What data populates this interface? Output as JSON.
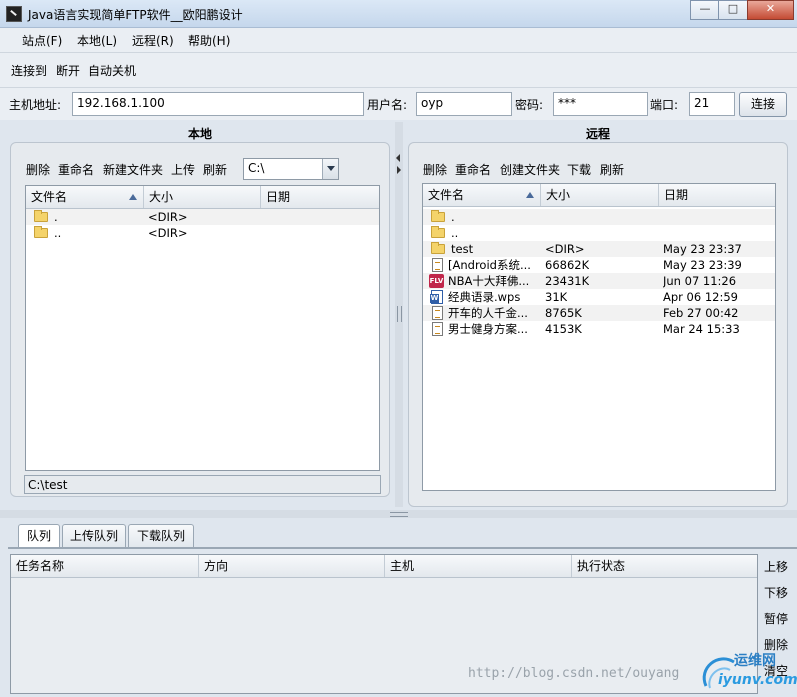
{
  "window": {
    "title": "Java语言实现简单FTP软件__欧阳鹏设计",
    "minimize_label": "—",
    "maximize_label": "□",
    "close_label": "✕"
  },
  "menu": {
    "items": [
      {
        "label": "站点(F)"
      },
      {
        "label": "本地(L)"
      },
      {
        "label": "远程(R)"
      },
      {
        "label": "帮助(H)"
      }
    ]
  },
  "toolbar": {
    "connect_to": "连接到",
    "disconnect": "断开",
    "auto_shutdown": "自动关机"
  },
  "connection": {
    "host_label": "主机地址:",
    "host_value": "192.168.1.100",
    "user_label": "用户名:",
    "user_value": "oyp",
    "password_label": "密码:",
    "password_value": "***",
    "port_label": "端口:",
    "port_value": "21",
    "connect_button": "连接"
  },
  "local": {
    "title": "本地",
    "toolbar": {
      "delete": "删除",
      "rename": "重命名",
      "new_folder": "新建文件夹",
      "upload": "上传",
      "refresh": "刷新"
    },
    "drive": "C:\\",
    "columns": [
      "文件名",
      "大小",
      "日期"
    ],
    "rows": [
      {
        "name": ".",
        "size": "<DIR>",
        "date": ""
      },
      {
        "name": "..",
        "size": "<DIR>",
        "date": ""
      }
    ],
    "path": "C:\\test"
  },
  "remote": {
    "title": "远程",
    "toolbar": {
      "delete": "删除",
      "rename": "重命名",
      "new_folder": "创建文件夹",
      "download": "下载",
      "refresh": "刷新"
    },
    "columns": [
      "文件名",
      "大小",
      "日期"
    ],
    "rows": [
      {
        "icon": "folder-icon",
        "name": ".",
        "size": "",
        "date": ""
      },
      {
        "icon": "folder-icon",
        "name": "..",
        "size": "",
        "date": ""
      },
      {
        "icon": "folder-icon",
        "name": "test",
        "size": "<DIR>",
        "date": "May 23 23:37"
      },
      {
        "icon": "file-icon",
        "name": "[Android系统...",
        "size": "66862K",
        "date": "May 23 23:39"
      },
      {
        "icon": "flv-icon",
        "icon_text": "FLV",
        "name": "NBA十大拜佛...",
        "size": "23431K",
        "date": "Jun 07 11:26"
      },
      {
        "icon": "wps-icon",
        "name": "经典语录.wps",
        "size": "31K",
        "date": "Apr 06 12:59"
      },
      {
        "icon": "file-icon",
        "name": "开车的人千金...",
        "size": "8765K",
        "date": "Feb 27 00:42"
      },
      {
        "icon": "file-icon",
        "name": "男士健身方案...",
        "size": "4153K",
        "date": "Mar 24 15:33"
      }
    ]
  },
  "queue": {
    "tabs": [
      {
        "label": "队列",
        "active": true
      },
      {
        "label": "上传队列",
        "active": false
      },
      {
        "label": "下载队列",
        "active": false
      }
    ],
    "columns": [
      "任务名称",
      "方向",
      "主机",
      "执行状态"
    ],
    "buttons": {
      "up": "上移",
      "down": "下移",
      "pause": "暂停",
      "delete": "删除",
      "clear": "清空"
    }
  },
  "watermark": {
    "url": "http://blog.csdn.net/ouyang",
    "logo_cn": "运维网",
    "logo_en": "iyunv.com"
  }
}
